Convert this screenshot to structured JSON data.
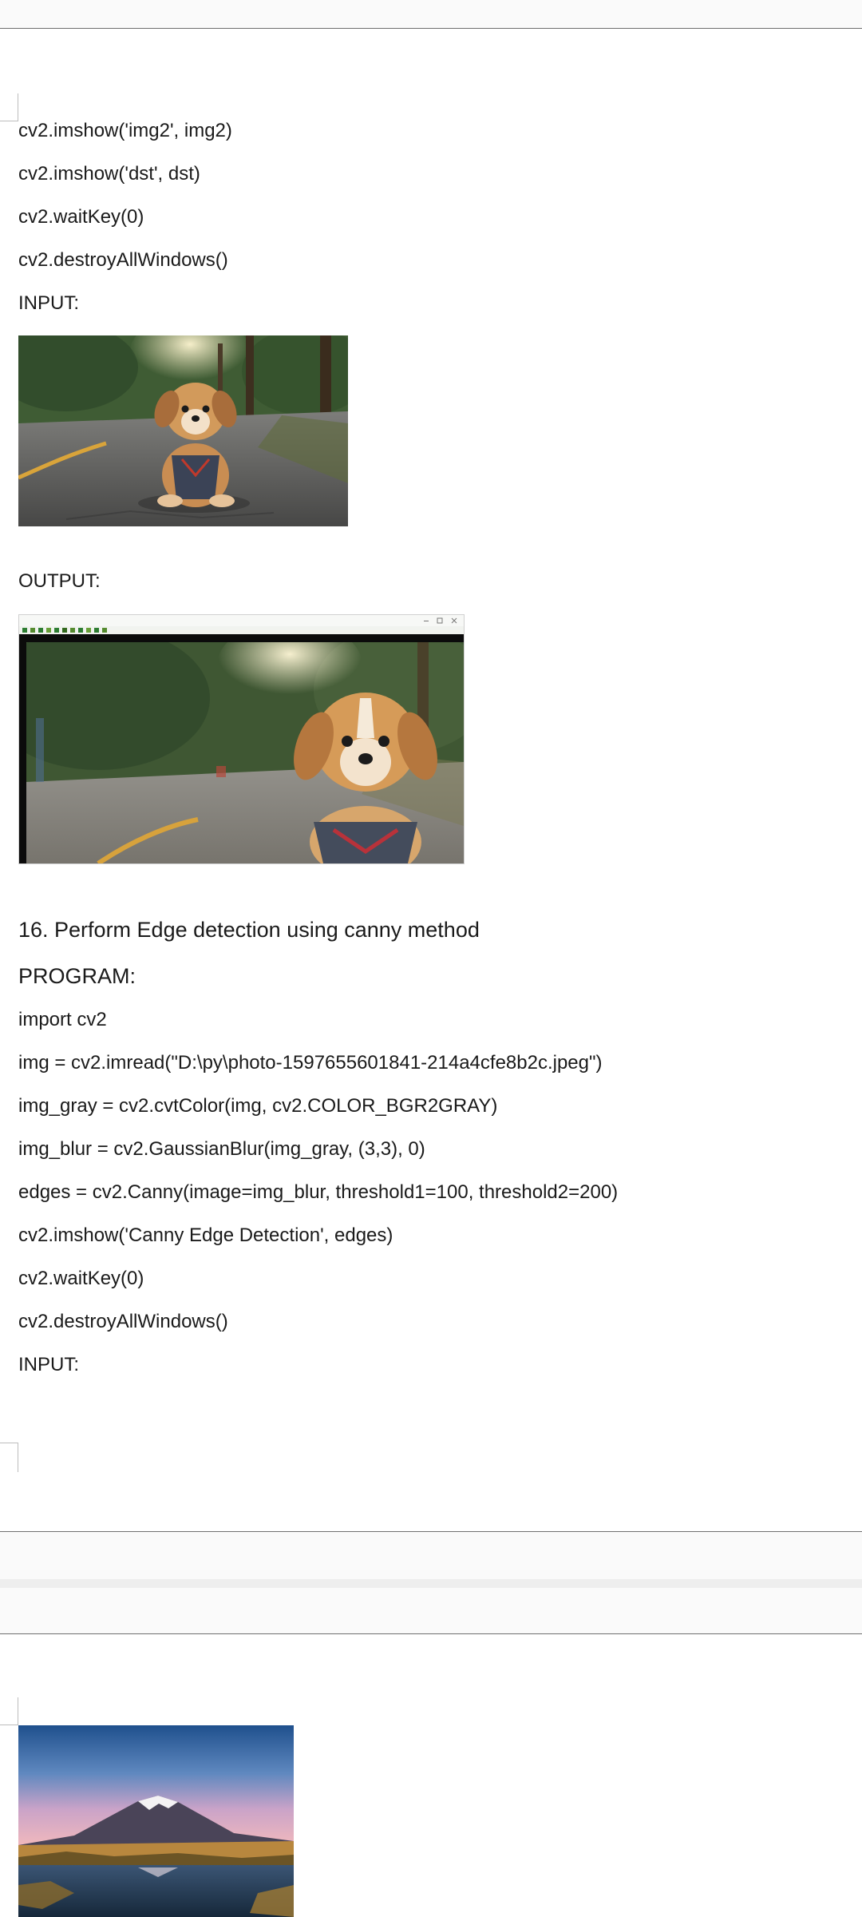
{
  "page1": {
    "code_continuation": [
      "cv2.imshow('img2', img2)",
      "cv2.imshow('dst', dst)",
      "cv2.waitKey(0)",
      "cv2.destroyAllWindows()"
    ],
    "input_label": "INPUT:",
    "output_label": "OUTPUT:",
    "section16": {
      "heading": "16. Perform Edge detection using canny method",
      "program_label": "PROGRAM:",
      "code_lines": [
        "import cv2",
        "img = cv2.imread(\"D:\\py\\photo-1597655601841-214a4cfe8b2c.jpeg\")",
        "img_gray = cv2.cvtColor(img, cv2.COLOR_BGR2GRAY)",
        "img_blur = cv2.GaussianBlur(img_gray, (3,3), 0)",
        "edges = cv2.Canny(image=img_blur, threshold1=100, threshold2=200)",
        "cv2.imshow('Canny Edge Detection', edges)",
        "cv2.waitKey(0)",
        "cv2.destroyAllWindows()"
      ],
      "input_label": "INPUT:"
    }
  },
  "images": {
    "input_photo_1": "puppy sitting on road",
    "output_photo": "puppy shown in OpenCV window",
    "input_photo_2": "snow-capped mountain reflected in lake"
  },
  "colors": {
    "page_background": "#ffffff",
    "band_background": "#fafafa",
    "separator": "#eeeeee",
    "rule": "#6e6e6e",
    "text": "#1a1a1a"
  }
}
